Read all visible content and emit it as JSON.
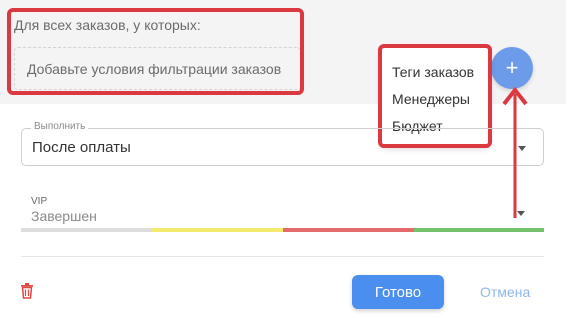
{
  "conditions": {
    "title": "Для всех заказов, у которых:",
    "placeholder": "Добавьте условия фильтрации заказов",
    "add_button_label": "+"
  },
  "menu": {
    "items": [
      {
        "label": "Теги заказов"
      },
      {
        "label": "Менеджеры"
      },
      {
        "label": "Бюджет"
      }
    ]
  },
  "execute": {
    "label": "Выполнить",
    "value": "После оплаты"
  },
  "pipeline": {
    "label": "VIP",
    "value": "Завершен",
    "stage_colors": [
      "#dddddd",
      "#f3ea6e",
      "#e36b6b",
      "#74c16e"
    ]
  },
  "footer": {
    "done_label": "Готово",
    "cancel_label": "Отмена",
    "trash_icon": "trash-icon"
  },
  "colors": {
    "annotation": "#d9393f",
    "accent": "#4a8ff0",
    "add_button": "#6c9bea",
    "danger": "#e04545"
  }
}
